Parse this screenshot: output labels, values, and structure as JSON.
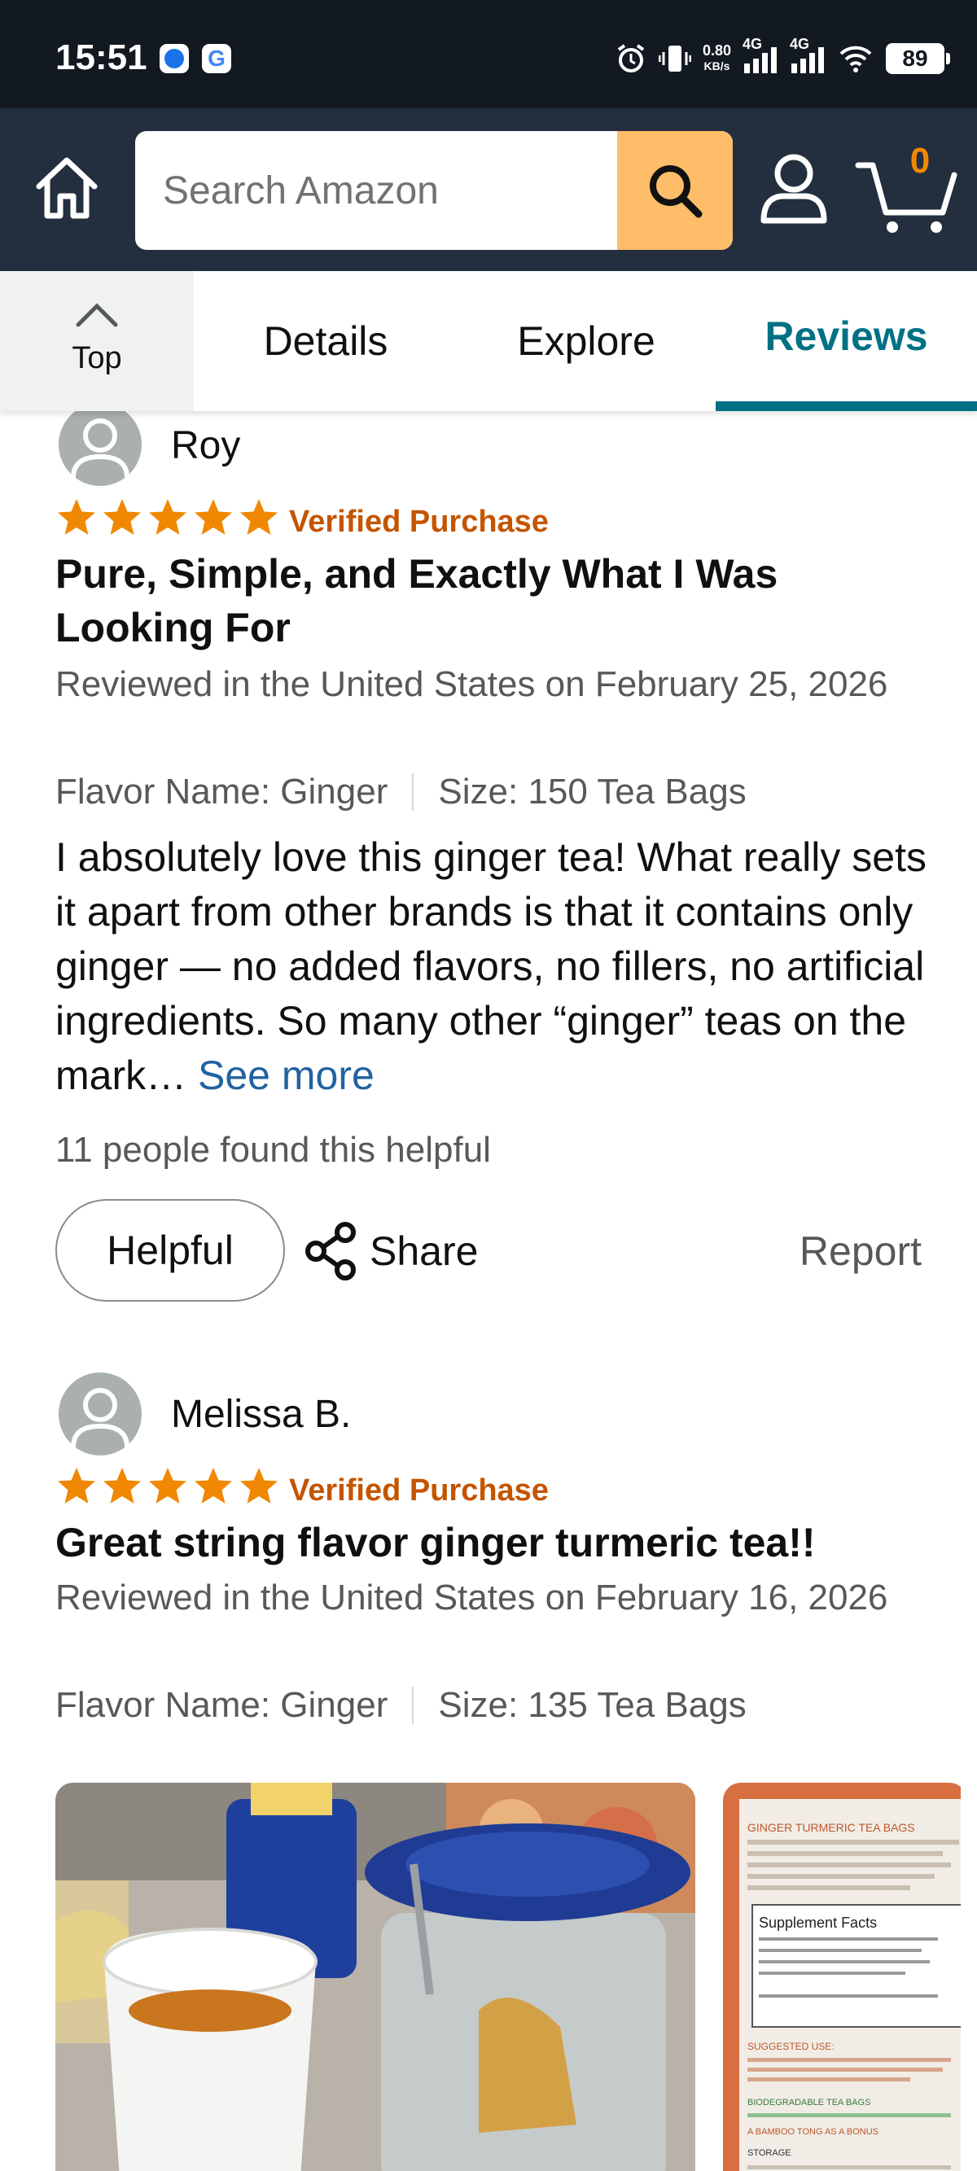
{
  "status_bar": {
    "time": "15:51",
    "net_speed_value": "0.80",
    "net_speed_unit": "KB/s",
    "net1": "4G",
    "net2": "4G",
    "battery": "89"
  },
  "header": {
    "search_placeholder": "Search Amazon",
    "cart_count": "0"
  },
  "tabs": {
    "top_label": "Top",
    "details": "Details",
    "explore": "Explore",
    "reviews": "Reviews",
    "active": "Reviews"
  },
  "reviews": [
    {
      "reviewer": "Roy",
      "rating": 5,
      "verified": "Verified Purchase",
      "title": "Pure, Simple, and Exactly What I Was Looking For",
      "date": "Reviewed in the United States on February 25, 2026",
      "flavor": "Flavor Name: Ginger",
      "size": "Size: 150 Tea Bags",
      "body": "I absolutely love this ginger tea! What really sets it apart from other brands is that it contains only ginger — no added flavors, no fillers, no artificial ingredients. So many other “ginger” teas on the mark…",
      "see_more": "See more",
      "helpful_count": "11 people found this helpful",
      "helpful_label": "Helpful",
      "share_label": "Share",
      "report_label": "Report"
    },
    {
      "reviewer": "Melissa B.",
      "rating": 5,
      "verified": "Verified Purchase",
      "title": "Great string flavor ginger turmeric tea!!",
      "date": "Reviewed in the United States on February 16, 2026",
      "flavor": "Flavor Name: Ginger",
      "size": "Size: 135 Tea Bags",
      "photo_texts": {
        "package_heading": "GINGER TURMERIC TEA BAGS",
        "supplement_facts": "Supplement Facts",
        "suggested_use": "SUGGESTED USE:",
        "biodegradable": "BIODEGRADABLE TEA BAGS",
        "bonus": "A BAMBOO TONG AS A BONUS",
        "storage": "STORAGE"
      }
    }
  ],
  "colors": {
    "header_bg": "#232f3e",
    "status_bg": "#131921",
    "accent_teal": "#007185",
    "star_orange": "#f08804",
    "verified_orange": "#c45500",
    "link_blue": "#2162a1",
    "search_button": "#febd69"
  },
  "icons": [
    "home-icon",
    "search-icon",
    "account-icon",
    "cart-icon",
    "chevron-up-icon",
    "star-icon",
    "share-icon",
    "avatar-icon"
  ]
}
